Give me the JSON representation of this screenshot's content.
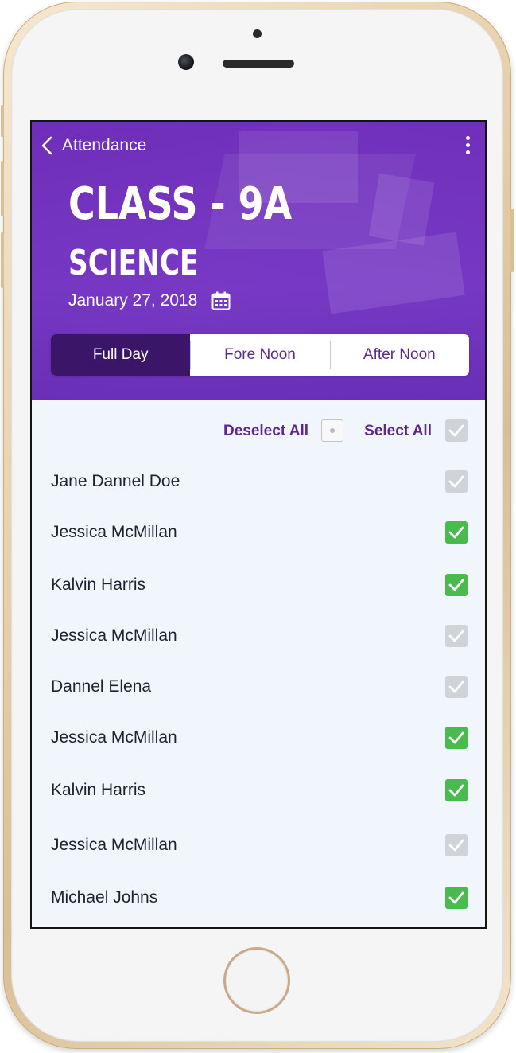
{
  "header": {
    "back_label": "Attendance",
    "class_title": "CLASS - 9A",
    "subject": "SCIENCE",
    "date": "January 27, 2018"
  },
  "tabs": [
    {
      "label": "Full Day",
      "active": true
    },
    {
      "label": "Fore Noon",
      "active": false
    },
    {
      "label": "After Noon",
      "active": false
    }
  ],
  "actions": {
    "deselect_label": "Deselect All",
    "select_label": "Select All",
    "select_all_checked": false
  },
  "students": [
    {
      "name": "Jane Dannel Doe",
      "present": false
    },
    {
      "name": "Jessica McMillan",
      "present": true
    },
    {
      "name": "Kalvin Harris",
      "present": true
    },
    {
      "name": "Jessica McMillan",
      "present": false
    },
    {
      "name": "Dannel Elena",
      "present": false
    },
    {
      "name": "Jessica McMillan",
      "present": true
    },
    {
      "name": "Kalvin Harris",
      "present": true
    },
    {
      "name": "Jessica McMillan",
      "present": false
    },
    {
      "name": "Michael Johns",
      "present": true
    }
  ],
  "colors": {
    "header_purple": "#7a3cc4",
    "active_tab": "#3b1668",
    "accent_text": "#5d2690",
    "check_on": "#49ba4e",
    "check_off": "#d0d3d7",
    "list_bg": "#f0f6fb"
  },
  "icons": {
    "back": "chevron-left-icon",
    "menu": "more-vertical-icon",
    "calendar": "calendar-icon",
    "check": "checkmark-icon"
  }
}
